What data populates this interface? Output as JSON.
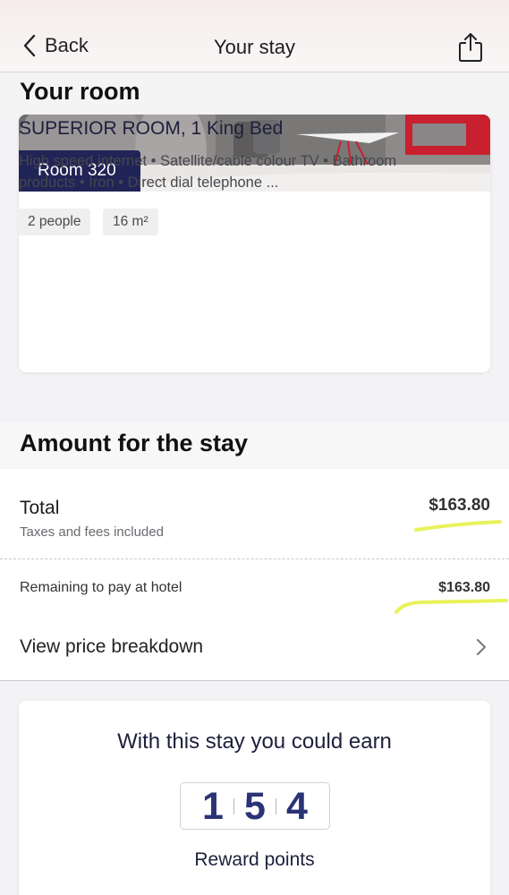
{
  "header": {
    "back_label": "Back",
    "title": "Your stay",
    "share_icon": "share-icon"
  },
  "room": {
    "section_title": "Your room",
    "badge": "Room 320",
    "name": "SUPERIOR ROOM, 1 King Bed",
    "amenities": "High speed internet • Satellite/cable colour TV • Bathroom products • Iron • Direct dial telephone ...",
    "chips": [
      "2 people",
      "16 m²"
    ]
  },
  "amount": {
    "section_title": "Amount for the stay",
    "total_label": "Total",
    "total_sub": "Taxes and fees included",
    "total_price": "$163.80",
    "remaining_label": "Remaining to pay at hotel",
    "remaining_price": "$163.80",
    "breakdown_label": "View price breakdown",
    "highlight_color": "#e8f25a"
  },
  "rewards": {
    "title": "With this stay you could earn",
    "digits": [
      "1",
      "5",
      "4"
    ],
    "subtitle": "Reward points",
    "digit_color": "#2a3375"
  },
  "colors": {
    "badge_bg": "#212456",
    "accent_red": "#c8202e"
  }
}
